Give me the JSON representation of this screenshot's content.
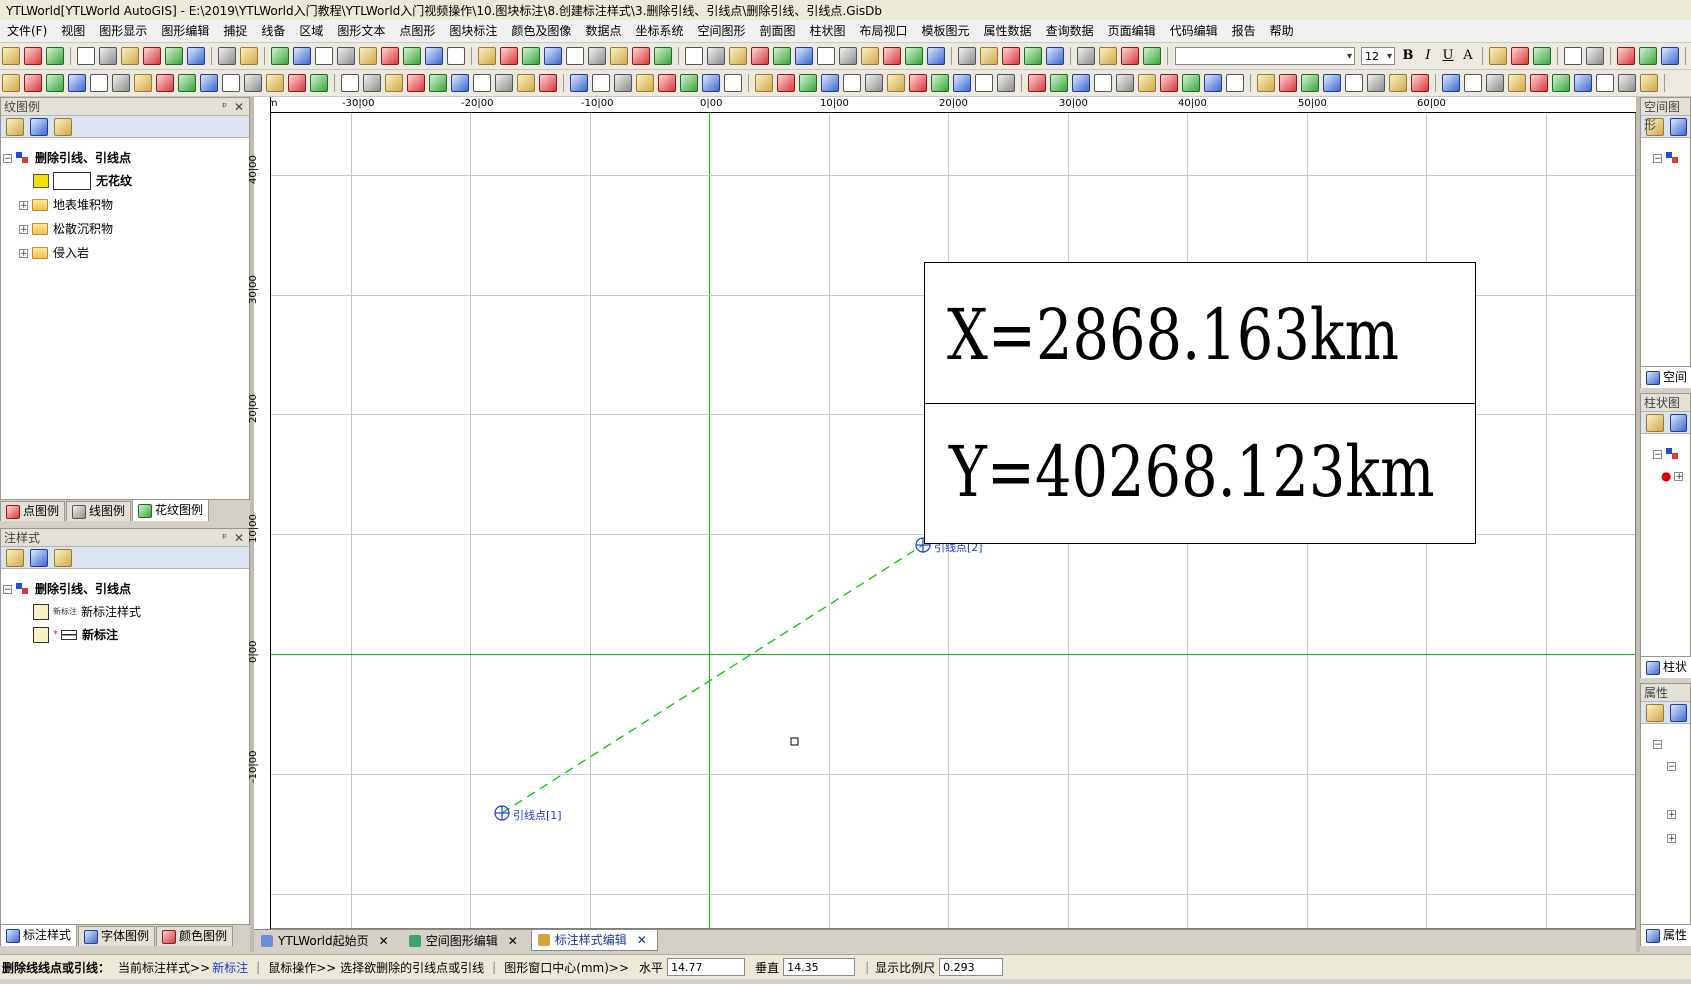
{
  "window": {
    "title": "YTLWorld[YTLWorld AutoGIS] - E:\\2019\\YTLWorld入门教程\\YTLWorld入门视频操作\\10.图块标注\\8.创建标注样式\\3.删除引线、引线点\\删除引线、引线点.GisDb"
  },
  "menu": [
    "文件(F)",
    "视图",
    "图形显示",
    "图形编辑",
    "捕捉",
    "线备",
    "区域",
    "图形文本",
    "点图形",
    "图块标注",
    "颜色及图像",
    "数据点",
    "坐标系统",
    "空间图形",
    "剖面图",
    "柱状图",
    "布局视口",
    "模板图元",
    "属性数据",
    "查询数据",
    "页面编辑",
    "代码编辑",
    "报告",
    "帮助"
  ],
  "toolbar": {
    "font_combo": "",
    "font_size": "12",
    "bold": "B",
    "italic": "I",
    "underline": "U",
    "font_color": "A"
  },
  "left_top_panel": {
    "title": "纹图例",
    "root": "删除引线、引线点",
    "pattern_label": "无花纹",
    "folders": [
      "地表堆积物",
      "松散沉积物",
      "侵入岩"
    ],
    "tabs": [
      "点图例",
      "线图例",
      "花纹图例"
    ]
  },
  "left_bottom_panel": {
    "title": "注样式",
    "root": "删除引线、引线点",
    "items": [
      {
        "small_label": "新标注",
        "label": "新标注样式"
      },
      {
        "small_label": "",
        "label": "新标注"
      }
    ],
    "tabs": [
      "标注样式",
      "字体图例",
      "颜色图例"
    ]
  },
  "right_panels": {
    "top_title": "空间图形",
    "top_tab": "空间",
    "mid_title": "柱状图",
    "mid_tab": "柱状",
    "bottom_title": "属性",
    "bottom_tab": "属性"
  },
  "ruler": {
    "unit": "mm",
    "x_ticks": [
      "-30|00",
      "-20|00",
      "-10|00",
      "0|00",
      "10|00",
      "20|00",
      "30|00",
      "40|00",
      "50|00",
      "60|00"
    ],
    "y_ticks": [
      "40|00",
      "30|00",
      "20|00",
      "10|00",
      "0|00",
      "-10|00"
    ]
  },
  "annotation": {
    "x_text": "X=2868.163km",
    "y_text": "Y=40268.123km",
    "leader_point_1": "引线点[1]",
    "leader_point_2": "引线点[2]",
    "leader_color": "#00c800"
  },
  "doc_tabs": [
    {
      "label": "YTLWorld起始页",
      "active": false
    },
    {
      "label": "空间图形编辑",
      "active": false
    },
    {
      "label": "标注样式编辑",
      "active": true
    }
  ],
  "status": {
    "prompt": "删除线线点或引线：",
    "style_label": "当前标注样式>>",
    "style_value": "新标注",
    "mouse_op": "鼠标操作>> 选择欲删除的引线点或引线",
    "center_label": "图形窗口中心(mm)>>",
    "h_label": "水平",
    "h_value": "14.77",
    "v_label": "垂直",
    "v_value": "14.35",
    "scale_label": "显示比例尺",
    "scale_value": "0.293"
  }
}
